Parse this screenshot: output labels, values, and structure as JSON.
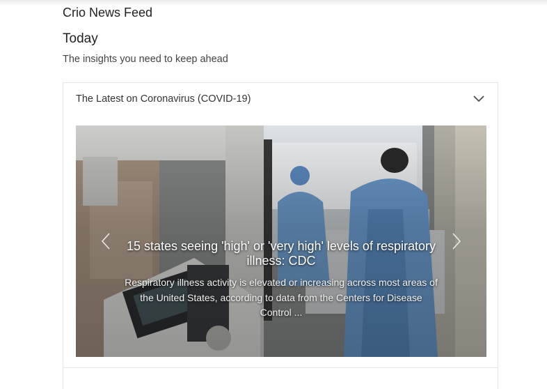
{
  "app": {
    "title": "Crio News Feed"
  },
  "section": {
    "title": "Today",
    "subtitle": "The insights you need to keep ahead"
  },
  "accordion": {
    "title": "The Latest on Coronavirus (COVID-19)",
    "expand_icon": "chevron-down-icon"
  },
  "carousel": {
    "prev_icon": "chevron-left-icon",
    "next_icon": "chevron-right-icon",
    "slide": {
      "headline": "15 states seeing 'high' or 'very high' levels of respiratory illness: CDC",
      "summary": "Respiratory illness activity is elevated or increasing across most areas of the United States, according to data from the Centers for Disease Control ..."
    },
    "image_description_colors": {
      "gown": "#6f9fd0",
      "wall": "#eef2f5",
      "equipment": "#d8d8d6"
    }
  }
}
